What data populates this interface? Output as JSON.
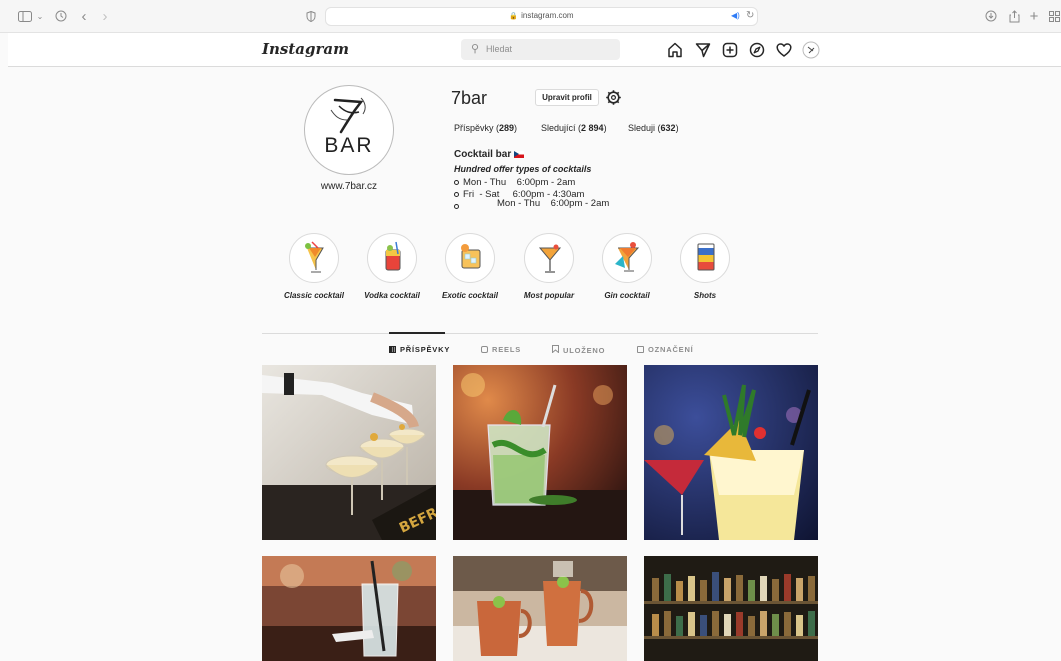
{
  "browser": {
    "url": "instagram.com"
  },
  "header": {
    "logo": "Instagram",
    "search_placeholder": "Hledat"
  },
  "profile": {
    "username": "7bar",
    "edit_button": "Upravit profil",
    "avatar_text": "BAR",
    "website": "www.7bar.cz",
    "stats": {
      "posts_label": "Příspěvky",
      "posts_count": "289",
      "followers_label": "Sledující",
      "followers_count": "2 894",
      "following_label": "Sleduji",
      "following_count": "632"
    },
    "bio": {
      "title": "Cocktail bar",
      "tagline": "Hundred offer types of cocktails",
      "line1": "Mon - Thu    6:00pm - 2am",
      "line2": "Fri  - Sat     6:00pm - 4:30am",
      "line3": "Mon - Thu    6:00pm - 2am"
    }
  },
  "highlights": [
    {
      "label": "Classic cocktail"
    },
    {
      "label": "Vodka cocktail"
    },
    {
      "label": "Exotic cocktail"
    },
    {
      "label": "Most popular"
    },
    {
      "label": "Gin cocktail"
    },
    {
      "label": "Shots"
    }
  ],
  "tabs": [
    {
      "label": "PŘÍSPĚVKY",
      "active": true
    },
    {
      "label": "REELS",
      "active": false
    },
    {
      "label": "ULOŽENO",
      "active": false
    },
    {
      "label": "OZNAČENÍ",
      "active": false
    }
  ],
  "colors": {
    "accent": "#262626",
    "muted": "#8e8e8e",
    "border": "#dbdbdb",
    "safari_blue": "#2f7cf6"
  }
}
